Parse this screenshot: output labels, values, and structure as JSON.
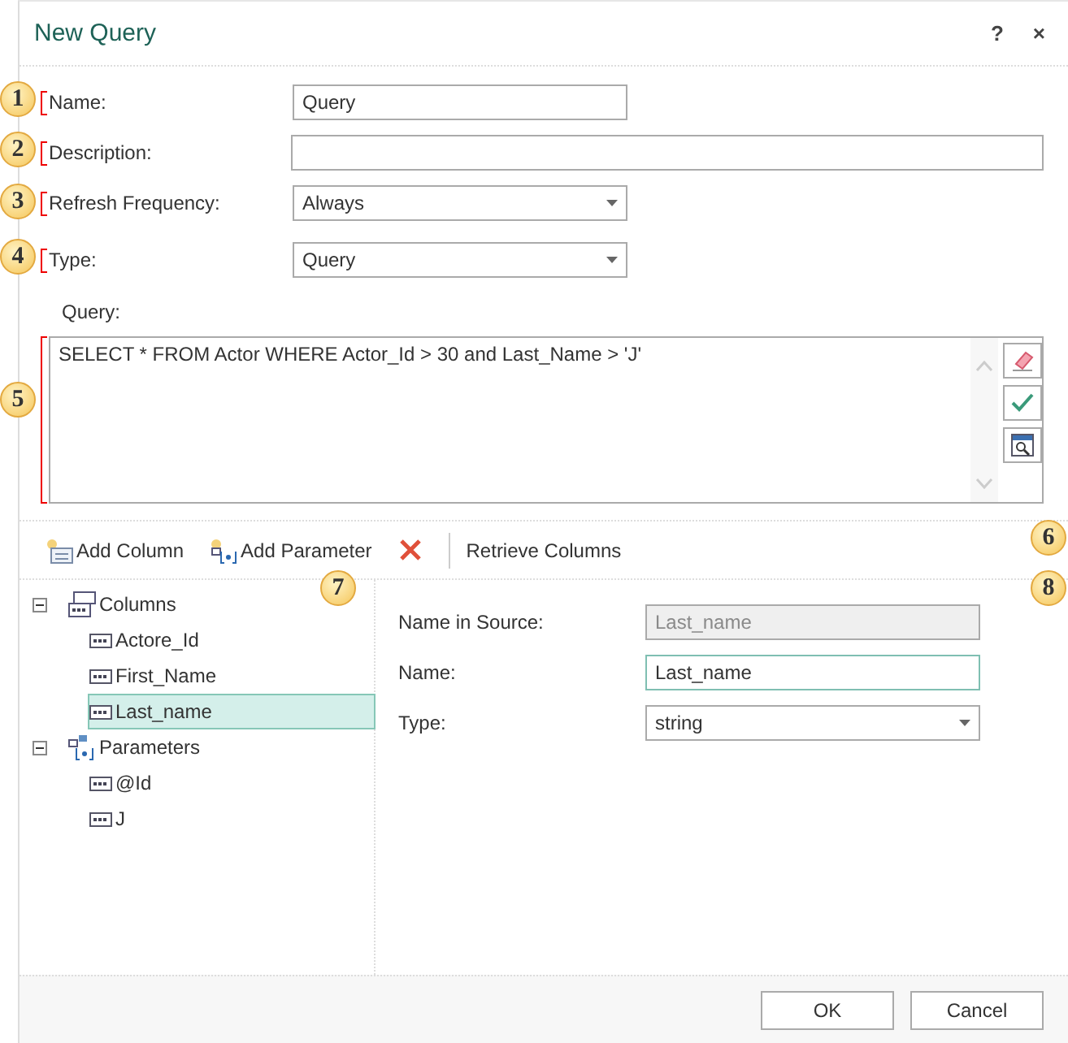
{
  "window": {
    "title": "New Query",
    "help": "?",
    "close": "×"
  },
  "callouts": [
    "1",
    "2",
    "3",
    "4",
    "5",
    "6",
    "7",
    "8"
  ],
  "fields": [
    {
      "label": "Name:",
      "kind": "text",
      "value": "Query"
    },
    {
      "label": "Description:",
      "kind": "text"
    },
    {
      "label": "Refresh Frequency:",
      "kind": "select",
      "value": "Always"
    },
    {
      "label": "Type:",
      "kind": "select",
      "value": "Query"
    }
  ],
  "query": {
    "label": "Query:",
    "text": "SELECT * FROM Actor WHERE Actor_Id > 30 and Last_Name > 'J'"
  },
  "toolbar": [
    {
      "kind": "add-column",
      "label": "Add Column"
    },
    {
      "kind": "add-parameter",
      "label": "Add Parameter"
    },
    {
      "kind": "delete"
    },
    {
      "kind": "text",
      "label": "Retrieve Columns"
    }
  ],
  "tree": [
    {
      "label": "Columns",
      "kind": "columns",
      "expanded": true,
      "children": [
        {
          "label": "Actore_Id",
          "selected": false
        },
        {
          "label": "First_Name",
          "selected": false
        },
        {
          "label": "Last_name",
          "selected": true
        }
      ]
    },
    {
      "label": "Parameters",
      "kind": "parameters",
      "expanded": true,
      "children": [
        {
          "label": "@Id",
          "selected": false
        },
        {
          "label": "J",
          "selected": false
        }
      ]
    }
  ],
  "properties": [
    {
      "label": "Name in Source:",
      "kind": "text",
      "value": "Last_name",
      "disabled": true,
      "focused": false
    },
    {
      "label": "Name:",
      "kind": "text",
      "value": "Last_name",
      "disabled": false,
      "focused": true
    },
    {
      "label": "Type:",
      "kind": "select",
      "value": "string",
      "disabled": false,
      "focused": false
    }
  ],
  "buttons": [
    "OK",
    "Cancel"
  ]
}
